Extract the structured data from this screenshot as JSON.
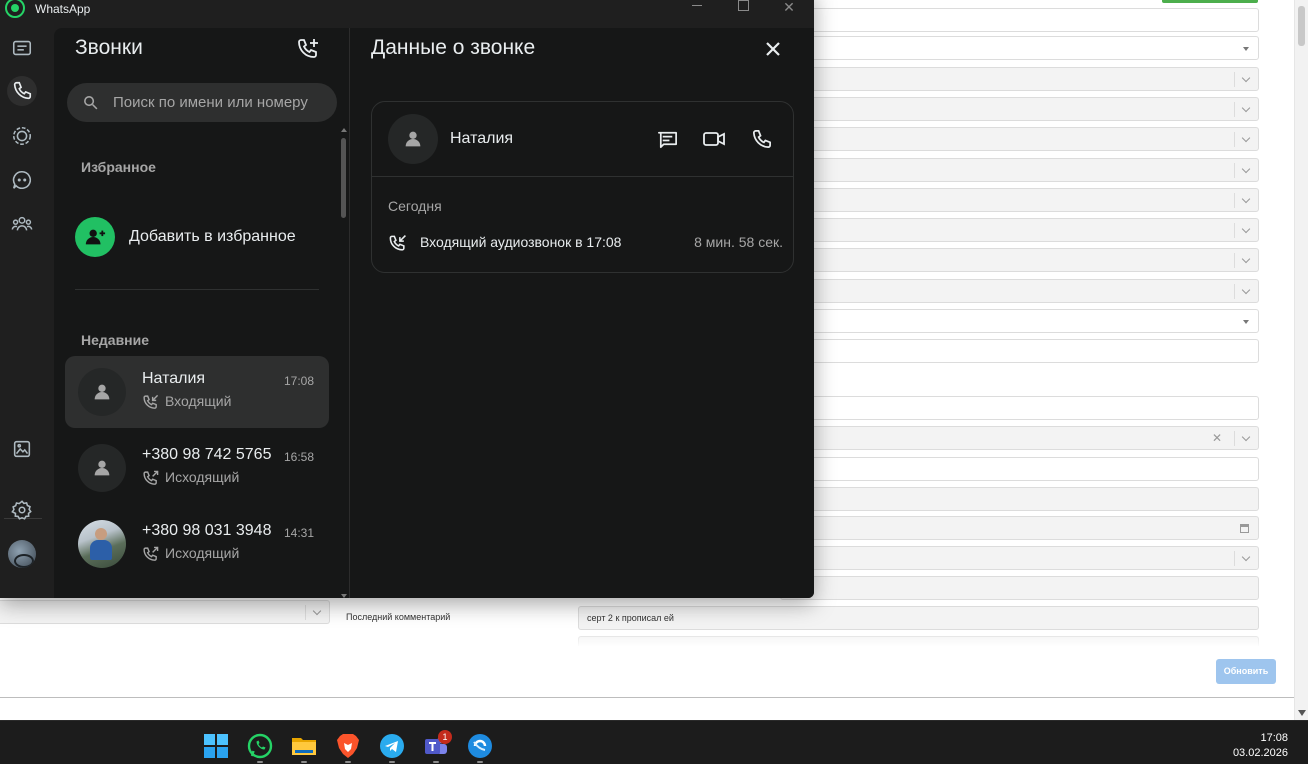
{
  "window": {
    "app_title": "WhatsApp"
  },
  "rail": {
    "items": [
      {
        "icon": "chats-icon"
      },
      {
        "icon": "calls-icon",
        "active": true
      },
      {
        "icon": "status-icon"
      },
      {
        "icon": "channels-icon"
      },
      {
        "icon": "communities-icon"
      },
      {
        "icon": "media-icon"
      },
      {
        "icon": "settings-icon"
      },
      {
        "icon": "profile-avatar"
      }
    ]
  },
  "calls_panel": {
    "title": "Звонки",
    "search_placeholder": "Поиск по имени или номеру",
    "favorites_title": "Избранное",
    "add_favorite_label": "Добавить в избранное",
    "recent_title": "Недавние",
    "recent": [
      {
        "name": "Наталия",
        "time": "17:08",
        "direction": "Входящий",
        "direction_icon": "incoming-call-icon",
        "selected": true
      },
      {
        "name": "+380 98 742 5765",
        "time": "16:58",
        "direction": "Исходящий",
        "direction_icon": "outgoing-call-icon"
      },
      {
        "name": "+380 98 031 3948",
        "time": "14:31",
        "direction": "Исходящий",
        "direction_icon": "outgoing-call-icon"
      }
    ]
  },
  "call_details": {
    "title": "Данные о звонке",
    "contact_name": "Наталия",
    "day_label": "Сегодня",
    "entry_description": "Входящий аудиозвонок в 17:08",
    "entry_duration": "8 мин. 58 сек."
  },
  "background_page": {
    "last_comment_label": "Последний комментарий",
    "last_comment_value": "серт 2 к прописал ей",
    "update_button": "Обновить"
  },
  "taskbar": {
    "apps": [
      "windows-start-icon",
      "whatsapp-icon",
      "file-explorer-icon",
      "brave-icon",
      "telegram-icon",
      "teams-icon",
      "skype-icon"
    ],
    "teams_badge": "1",
    "time": "17:08",
    "date": "03.02.2026"
  },
  "colors": {
    "accent_green": "#21c063",
    "panel_bg": "#161717",
    "rail_bg": "#1f1f1f",
    "text_primary": "#e9edef",
    "text_secondary": "#a6a6a6"
  }
}
